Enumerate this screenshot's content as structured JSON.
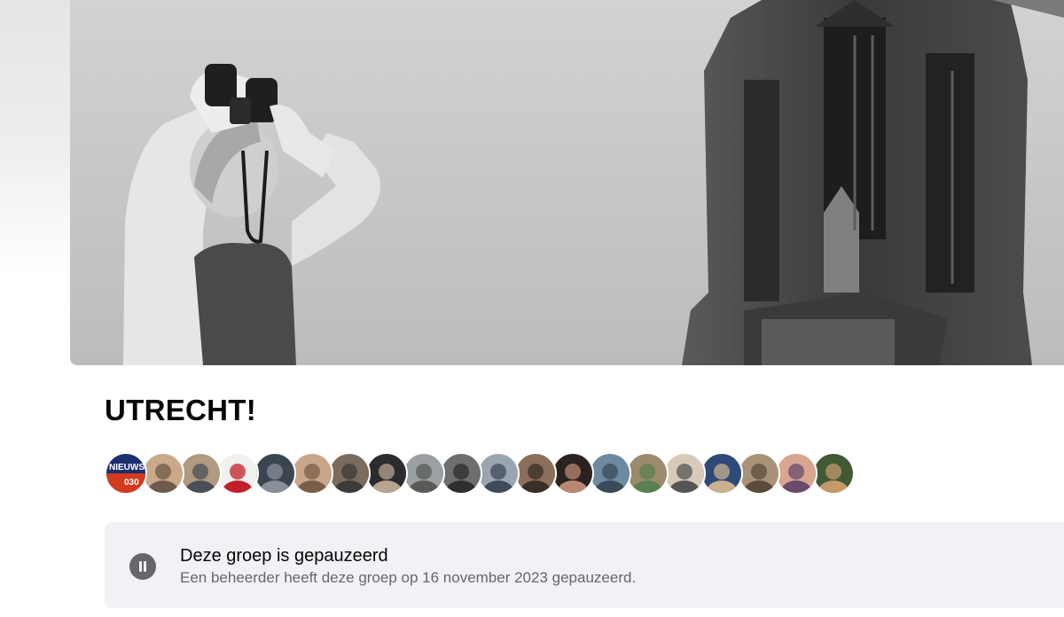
{
  "group": {
    "title": "UTRECHT!"
  },
  "members": {
    "avatars": [
      {
        "name": "nieuws-030-avatar",
        "text": "NIEUWS 030",
        "colors": [
          "#1b2f6e",
          "#d43a1e"
        ]
      },
      {
        "name": "member-avatar",
        "colors": [
          "#c9a98a",
          "#6d5a4a"
        ]
      },
      {
        "name": "member-avatar",
        "colors": [
          "#b09a80",
          "#4a4f55"
        ]
      },
      {
        "name": "member-avatar",
        "colors": [
          "#f3f1ef",
          "#c21f2b"
        ]
      },
      {
        "name": "member-avatar",
        "colors": [
          "#3b4552",
          "#8a8f99"
        ]
      },
      {
        "name": "member-avatar",
        "colors": [
          "#c9a58a",
          "#7b5e48"
        ]
      },
      {
        "name": "member-avatar",
        "colors": [
          "#7a6b5e",
          "#3c3b37"
        ]
      },
      {
        "name": "member-avatar",
        "colors": [
          "#2c2b2f",
          "#b8a48f"
        ]
      },
      {
        "name": "member-avatar",
        "colors": [
          "#9aa0a4",
          "#5a5b56"
        ]
      },
      {
        "name": "member-avatar",
        "colors": [
          "#6e6e6e",
          "#2e2e2e"
        ]
      },
      {
        "name": "member-avatar",
        "colors": [
          "#9aa5b1",
          "#3f4b57"
        ]
      },
      {
        "name": "member-avatar",
        "colors": [
          "#8b6f5b",
          "#3a2f28"
        ]
      },
      {
        "name": "member-avatar",
        "colors": [
          "#2b2220",
          "#b98872"
        ]
      },
      {
        "name": "member-avatar",
        "colors": [
          "#6e8aa0",
          "#3b4a58"
        ]
      },
      {
        "name": "member-avatar",
        "colors": [
          "#9c8a6d",
          "#5a7f52"
        ]
      },
      {
        "name": "member-avatar",
        "colors": [
          "#d8c9b8",
          "#555555"
        ]
      },
      {
        "name": "member-avatar",
        "colors": [
          "#2d4a7a",
          "#c9b08e"
        ]
      },
      {
        "name": "member-avatar",
        "colors": [
          "#a89278",
          "#5c4a3a"
        ]
      },
      {
        "name": "member-avatar",
        "colors": [
          "#d8a590",
          "#6a4b6d"
        ]
      },
      {
        "name": "member-avatar",
        "colors": [
          "#3f5a34",
          "#c49a6a"
        ]
      }
    ]
  },
  "notice": {
    "icon": "pause-icon",
    "title": "Deze groep is gepauzeerd",
    "text": "Een beheerder heeft deze groep op 16 november 2023 gepauzeerd."
  }
}
